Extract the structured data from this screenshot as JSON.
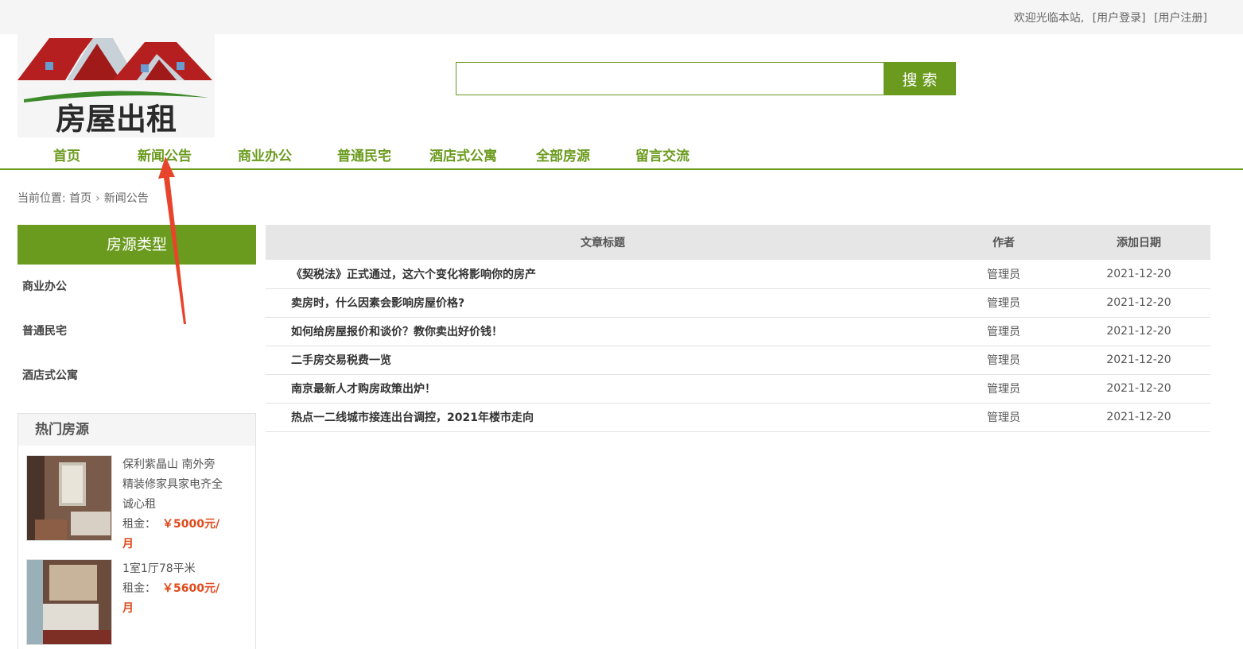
{
  "topbar": {
    "welcome": "欢迎光临本站,",
    "login": "[用户登录]",
    "register": "[用户注册]"
  },
  "logo": {
    "text": "房屋出租"
  },
  "search": {
    "placeholder": "",
    "button": "搜索"
  },
  "nav": {
    "items": [
      {
        "label": "首页"
      },
      {
        "label": "新闻公告"
      },
      {
        "label": "商业办公"
      },
      {
        "label": "普通民宅"
      },
      {
        "label": "酒店式公寓"
      },
      {
        "label": "全部房源"
      },
      {
        "label": "留言交流"
      }
    ]
  },
  "breadcrumb": {
    "prefix": "当前位置:",
    "home": "首页",
    "sep": "›",
    "current": "新闻公告"
  },
  "sidebar": {
    "title": "房源类型",
    "items": [
      {
        "label": "商业办公"
      },
      {
        "label": "普通民宅"
      },
      {
        "label": "酒店式公寓"
      }
    ]
  },
  "hot": {
    "title": "热门房源",
    "price_label": "租金：",
    "items": [
      {
        "title": "保利紫晶山 南外旁精装修家具家电齐全 诚心租",
        "price": "￥5000元/月"
      },
      {
        "title": "1室1厅78平米",
        "price": "￥5600元/月"
      }
    ]
  },
  "table": {
    "headers": [
      "文章标题",
      "作者",
      "添加日期"
    ],
    "rows": [
      {
        "title": "《契税法》正式通过，这六个变化将影响你的房产",
        "author": "管理员",
        "date": "2021-12-20"
      },
      {
        "title": "卖房时，什么因素会影响房屋价格?",
        "author": "管理员",
        "date": "2021-12-20"
      },
      {
        "title": "如何给房屋报价和谈价？教你卖出好价钱！",
        "author": "管理员",
        "date": "2021-12-20"
      },
      {
        "title": "二手房交易税费一览",
        "author": "管理员",
        "date": "2021-12-20"
      },
      {
        "title": "南京最新人才购房政策出炉！",
        "author": "管理员",
        "date": "2021-12-20"
      },
      {
        "title": "热点一二线城市接连出台调控，2021年楼市走向",
        "author": "管理员",
        "date": "2021-12-20"
      }
    ]
  },
  "colors": {
    "accent": "#6b9b1e",
    "price": "#e04a1c",
    "annotation": "#e8442b"
  }
}
